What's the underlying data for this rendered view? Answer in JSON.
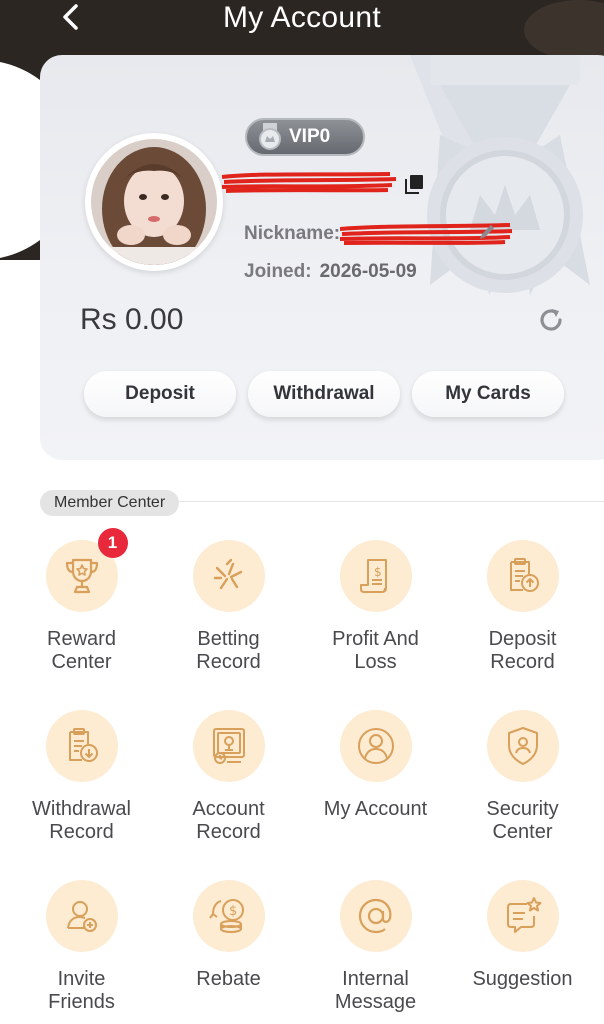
{
  "header": {
    "title": "My Account"
  },
  "account": {
    "vip_label": "VIP0",
    "nickname_label": "Nickname:",
    "joined_label": "Joined:",
    "joined_date": "2026-05-09",
    "balance": "Rs 0.00"
  },
  "actions": {
    "deposit": "Deposit",
    "withdrawal": "Withdrawal",
    "my_cards": "My Cards"
  },
  "member_center": {
    "title": "Member Center",
    "items": [
      {
        "label": "Reward\nCenter",
        "icon": "trophy-icon",
        "badge": "1"
      },
      {
        "label": "Betting\nRecord",
        "icon": "betting-record-icon"
      },
      {
        "label": "Profit And\nLoss",
        "icon": "receipt-icon"
      },
      {
        "label": "Deposit\nRecord",
        "icon": "deposit-record-icon"
      },
      {
        "label": "Withdrawal\nRecord",
        "icon": "withdrawal-record-icon"
      },
      {
        "label": "Account\nRecord",
        "icon": "account-record-icon"
      },
      {
        "label": "My Account",
        "icon": "user-icon"
      },
      {
        "label": "Security\nCenter",
        "icon": "shield-icon"
      },
      {
        "label": "Invite\nFriends",
        "icon": "invite-friends-icon"
      },
      {
        "label": "Rebate",
        "icon": "coins-icon"
      },
      {
        "label": "Internal\nMessage",
        "icon": "at-sign-icon"
      },
      {
        "label": "Suggestion",
        "icon": "suggestion-icon"
      }
    ]
  },
  "colors": {
    "header_bg": "#2c2622",
    "icon_circle_bg": "#fdebd2",
    "icon_stroke": "#d8a05a",
    "badge_red": "#e8283b",
    "redaction_red": "#e0241b"
  }
}
